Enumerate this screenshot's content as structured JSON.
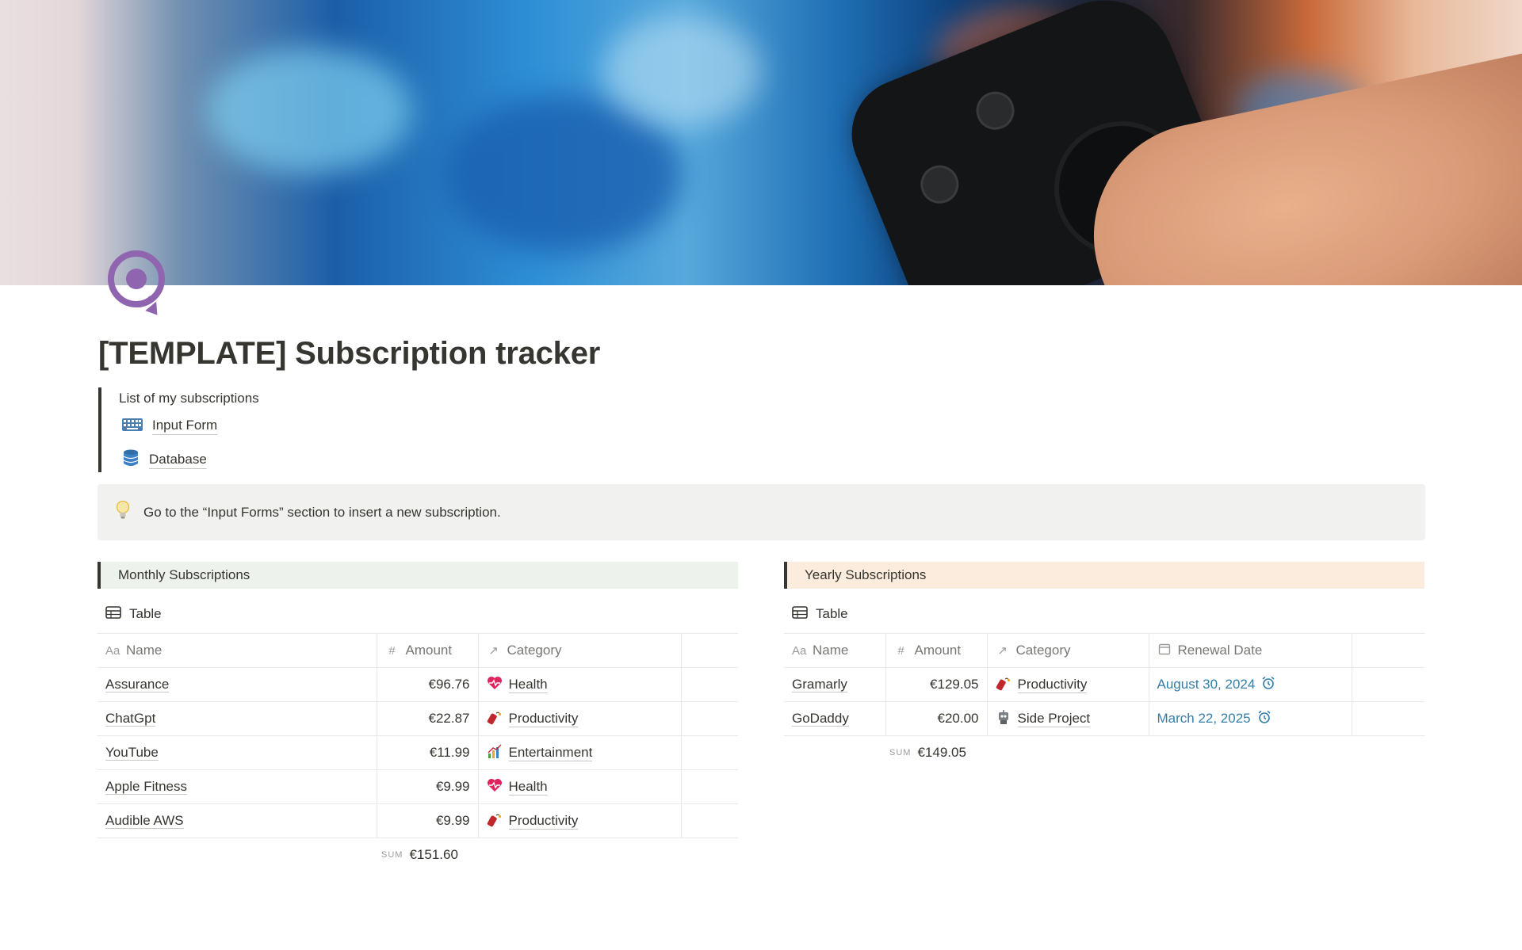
{
  "page": {
    "title": "[TEMPLATE] Subscription tracker",
    "icon": "target-refresh-icon"
  },
  "quote": {
    "text": "List of my subscriptions",
    "links": [
      {
        "label": "Input Form",
        "icon": "keyboard-icon"
      },
      {
        "label": "Database",
        "icon": "database-icon"
      }
    ]
  },
  "callout": {
    "icon": "lightbulb-icon",
    "text": "Go to the “Input Forms” section to insert a new subscription."
  },
  "monthly": {
    "heading": "Monthly Subscriptions",
    "view_label": "Table",
    "columns": [
      "Name",
      "Amount",
      "Category"
    ],
    "rows": [
      {
        "name": "Assurance",
        "amount": "€96.76",
        "category": "Health",
        "category_icon": "heart-icon"
      },
      {
        "name": "ChatGpt",
        "amount": "€22.87",
        "category": "Productivity",
        "category_icon": "dynamite-icon"
      },
      {
        "name": "YouTube",
        "amount": "€11.99",
        "category": "Entertainment",
        "category_icon": "chart-icon"
      },
      {
        "name": "Apple Fitness",
        "amount": "€9.99",
        "category": "Health",
        "category_icon": "heart-icon"
      },
      {
        "name": "Audible AWS",
        "amount": "€9.99",
        "category": "Productivity",
        "category_icon": "dynamite-icon"
      }
    ],
    "sum_label": "SUM",
    "sum_value": "€151.60"
  },
  "yearly": {
    "heading": "Yearly Subscriptions",
    "view_label": "Table",
    "columns": [
      "Name",
      "Amount",
      "Category",
      "Renewal Date"
    ],
    "rows": [
      {
        "name": "Gramarly",
        "amount": "€129.05",
        "category": "Productivity",
        "category_icon": "dynamite-icon",
        "renewal": "August 30, 2024"
      },
      {
        "name": "GoDaddy",
        "amount": "€20.00",
        "category": "Side Project",
        "category_icon": "robot-icon",
        "renewal": "March 22, 2025"
      }
    ],
    "sum_label": "SUM",
    "sum_value": "€149.05"
  },
  "colors": {
    "text": "#37352f",
    "muted": "#787774",
    "link_blue": "#337ea9",
    "monthly_header_bg": "#edf3ec",
    "yearly_header_bg": "#fbecdd",
    "callout_bg": "#f1f1ef",
    "icon_purple": "#9065b0"
  }
}
